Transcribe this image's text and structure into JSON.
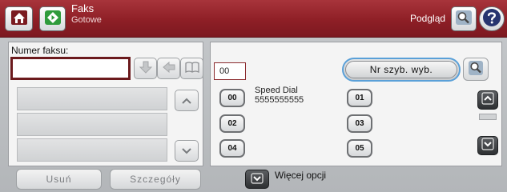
{
  "header": {
    "title": "Faks",
    "subtitle": "Gotowe",
    "preview_label": "Podgląd",
    "icons": {
      "home": "home-icon",
      "fax": "fax-start-icon",
      "preview": "magnifier-icon",
      "help": "help-icon"
    }
  },
  "left": {
    "fax_number_label": "Numer faksu:",
    "fax_number_value": "",
    "input_buttons": [
      "arrow-down-icon",
      "backspace-arrow-icon",
      "phone-book-icon"
    ],
    "list_rows": [
      "",
      "",
      ""
    ],
    "delete_label": "Usuń",
    "details_label": "Szczegóły"
  },
  "right": {
    "speed_code_value": "00",
    "speed_dial_button_label": "Nr szyb. wyb.",
    "entries": [
      {
        "number": "00",
        "name": "Speed Dial",
        "fax": "5555555555"
      },
      {
        "number": "01",
        "name": "",
        "fax": ""
      },
      {
        "number": "02",
        "name": "",
        "fax": ""
      },
      {
        "number": "03",
        "name": "",
        "fax": ""
      },
      {
        "number": "04",
        "name": "",
        "fax": ""
      },
      {
        "number": "05",
        "name": "",
        "fax": ""
      }
    ],
    "more_options_label": "Więcej opcji"
  },
  "colors": {
    "header_red": "#8e1f26",
    "accent_blue": "#5aa0d8",
    "fax_icon_green": "#2f9b3b"
  }
}
